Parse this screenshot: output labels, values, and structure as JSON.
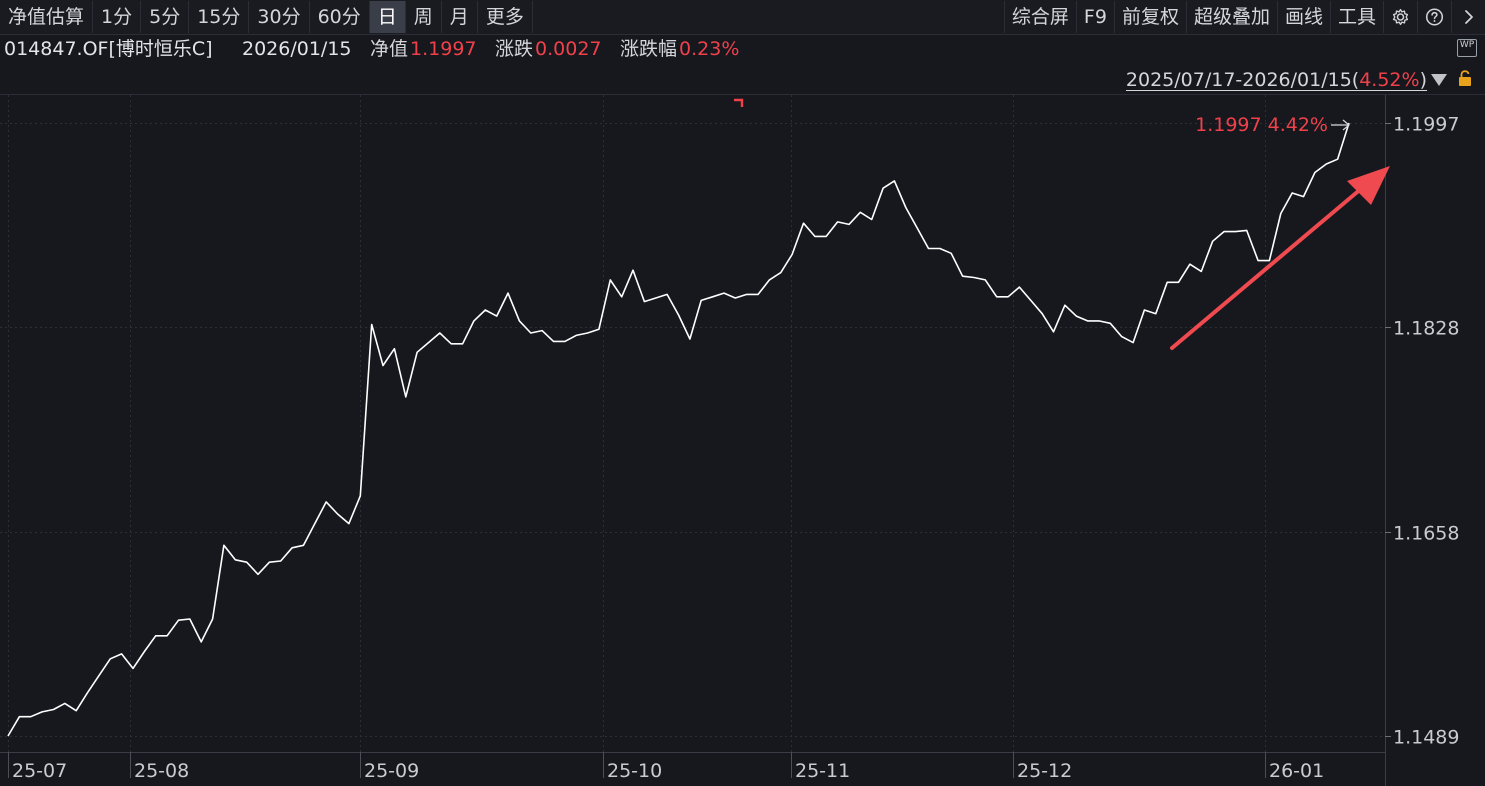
{
  "toolbar": {
    "left_tabs": [
      {
        "label": "净值估算",
        "active": false
      },
      {
        "label": "1分",
        "active": false
      },
      {
        "label": "5分",
        "active": false
      },
      {
        "label": "15分",
        "active": false
      },
      {
        "label": "30分",
        "active": false
      },
      {
        "label": "60分",
        "active": false
      },
      {
        "label": "日",
        "active": true
      },
      {
        "label": "周",
        "active": false
      },
      {
        "label": "月",
        "active": false
      },
      {
        "label": "更多",
        "active": false
      }
    ],
    "right_buttons": [
      {
        "label": "综合屏"
      },
      {
        "label": "F9"
      },
      {
        "label": "前复权"
      },
      {
        "label": "超级叠加"
      },
      {
        "label": "画线"
      },
      {
        "label": "工具"
      }
    ],
    "icons": [
      "gear-icon",
      "help-icon",
      "chevron-right-icon"
    ]
  },
  "info": {
    "code": "014847.OF[博时恒乐C]",
    "date": "2026/01/15",
    "nav_label": "净值",
    "nav_value": "1.1997",
    "change_label": "涨跌",
    "change_value": "0.0027",
    "change_pct_label": "涨跌幅",
    "change_pct_value": "0.23%",
    "wp_icon": "WP"
  },
  "range": {
    "text": "2025/07/17-2026/01/15",
    "open": "(",
    "pct": "4.52%",
    "close": ")"
  },
  "colors": {
    "background": "#16181e",
    "line": "#ffffff",
    "up": "#f0414b",
    "grid": "#2c2f37",
    "axis_text": "#c8cbd0",
    "arrow": "#ef4a4f"
  },
  "chart_data": {
    "type": "line",
    "ylim": [
      1.1489,
      1.2
    ],
    "y_ticks": [
      "1.1997",
      "1.1828",
      "1.1658",
      "1.1489"
    ],
    "x_ticks": [
      "25-07",
      "25-08",
      "25-09",
      "25-10",
      "25-11",
      "25-12",
      "26-01"
    ],
    "last_label": "1.1997 4.42%",
    "series": [
      {
        "values": [
          1.1489,
          1.1505,
          1.1505,
          1.1509,
          1.1511,
          1.1516,
          1.151,
          1.1525,
          1.1539,
          1.1553,
          1.1557,
          1.1545,
          1.1559,
          1.1572,
          1.1572,
          1.1585,
          1.1586,
          1.1567,
          1.1586,
          1.1647,
          1.1635,
          1.1633,
          1.1623,
          1.1633,
          1.1634,
          1.1645,
          1.1647,
          1.1665,
          1.1683,
          1.1673,
          1.1665,
          1.1688,
          1.183,
          1.1796,
          1.181,
          1.177,
          1.1807,
          1.1815,
          1.1823,
          1.1814,
          1.1814,
          1.1833,
          1.1842,
          1.1837,
          1.1856,
          1.1833,
          1.1823,
          1.1825,
          1.1816,
          1.1816,
          1.1821,
          1.1823,
          1.1826,
          1.1867,
          1.1853,
          1.1875,
          1.1849,
          1.1852,
          1.1855,
          1.1838,
          1.1818,
          1.185,
          1.1853,
          1.1856,
          1.1852,
          1.1855,
          1.1855,
          1.1867,
          1.1873,
          1.1888,
          1.1914,
          1.1903,
          1.1903,
          1.1915,
          1.1913,
          1.1923,
          1.1917,
          1.1943,
          1.1949,
          1.1927,
          1.191,
          1.1893,
          1.1893,
          1.1889,
          1.187,
          1.1869,
          1.1867,
          1.1853,
          1.1853,
          1.1861,
          1.185,
          1.1839,
          1.1824,
          1.1846,
          1.1837,
          1.1833,
          1.1833,
          1.1831,
          1.182,
          1.1815,
          1.1842,
          1.1839,
          1.1865,
          1.1865,
          1.188,
          1.1874,
          1.1899,
          1.1907,
          1.1907,
          1.1908,
          1.1883,
          1.1883,
          1.1922,
          1.1939,
          1.1936,
          1.1956,
          1.1963,
          1.1967,
          1.1997
        ]
      }
    ]
  }
}
